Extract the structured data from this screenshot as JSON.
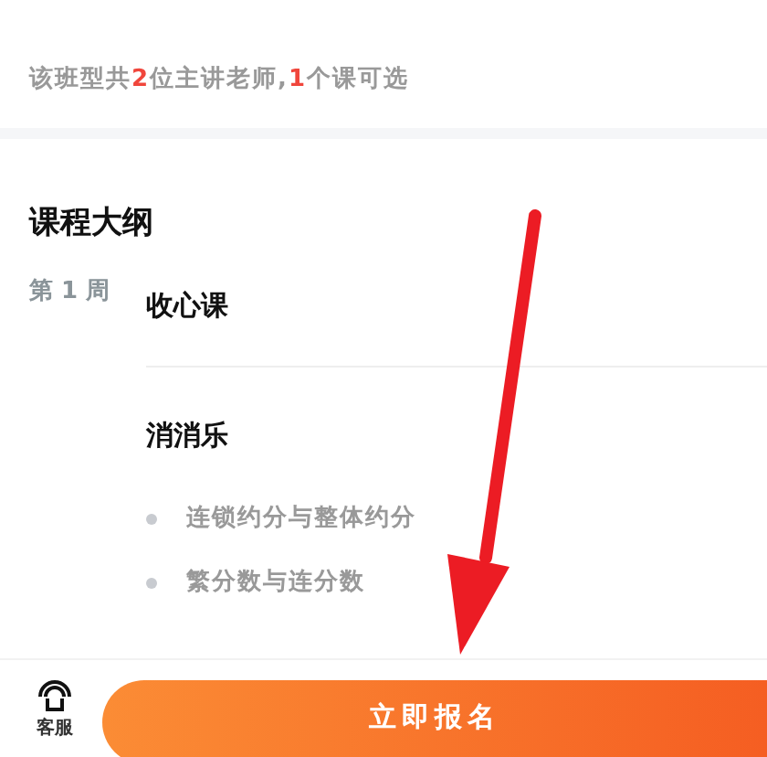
{
  "summary": [
    {
      "text": "该班型共",
      "highlight": false
    },
    {
      "text": "2",
      "highlight": true
    },
    {
      "text": "位主讲老师,",
      "highlight": false
    },
    {
      "text": "1",
      "highlight": true
    },
    {
      "text": "个课可选",
      "highlight": false
    }
  ],
  "outline": {
    "title": "课程大纲",
    "weeks": [
      {
        "label": "第 1 周",
        "lessons": [
          {
            "title": "收心课"
          },
          {
            "title": "消消乐",
            "topics": [
              "连锁约分与整体约分",
              "繁分数与连分数"
            ]
          }
        ]
      }
    ]
  },
  "bottom_bar": {
    "service_label": "客服",
    "enroll_button": "立即报名"
  },
  "annotation": {
    "kind": "arrow"
  }
}
